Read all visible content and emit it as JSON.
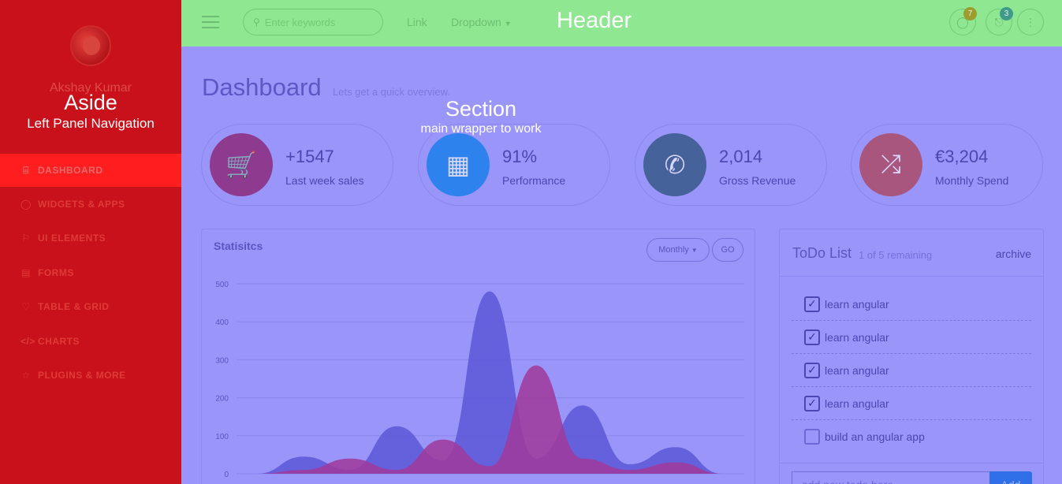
{
  "aside": {
    "user_name": "Akshay Kumar",
    "title": "Aside",
    "subtitle": "Left Panel Navigation",
    "nav": [
      {
        "label": "DASHBOARD",
        "icon": "bookmark-icon",
        "glyph": "⌸",
        "active": true
      },
      {
        "label": "WIDGETS & APPS",
        "icon": "comment-icon",
        "glyph": "◯",
        "active": false
      },
      {
        "label": "UI ELEMENTS",
        "icon": "flag-icon",
        "glyph": "⚐",
        "active": false
      },
      {
        "label": "FORMS",
        "icon": "file-icon",
        "glyph": "▤",
        "active": false
      },
      {
        "label": "TABLE & GRID",
        "icon": "heart-icon",
        "glyph": "♡",
        "active": false
      },
      {
        "label": "CHARTS",
        "icon": "code-icon",
        "glyph": "</>",
        "active": false
      },
      {
        "label": "PLUGINS & MORE",
        "icon": "star-icon",
        "glyph": "☆",
        "active": false
      }
    ]
  },
  "header": {
    "title": "Header",
    "search_placeholder": "Enter keywords",
    "link": "Link",
    "dropdown": "Dropdown",
    "messages_badge": "7",
    "notifications_badge": "3"
  },
  "main": {
    "title": "Dashboard",
    "subtitle": "Lets get a quick overview.",
    "section_title": "Section",
    "section_subtitle": "main wrapper to work",
    "stats": [
      {
        "value": "+1547",
        "label": "Last week sales",
        "icon": "cart-icon",
        "color": "#8e3a8e"
      },
      {
        "value": "91%",
        "label": "Performance",
        "icon": "qrcode-icon",
        "color": "#2d82ee"
      },
      {
        "value": "2,014",
        "label": "Gross Revenue",
        "icon": "phone-icon",
        "color": "#46629a"
      },
      {
        "value": "€3,204",
        "label": "Monthly Spend",
        "icon": "shuffle-icon",
        "color": "#a8567e"
      }
    ],
    "statistics": {
      "title": "Statisitcs",
      "period_select": "Monthly",
      "go_label": "GO"
    },
    "todo": {
      "title": "ToDo List",
      "count": "1 of 5 remaining",
      "archive": "archive",
      "items": [
        {
          "text": "learn angular",
          "done": true
        },
        {
          "text": "learn angular",
          "done": true
        },
        {
          "text": "learn angular",
          "done": true
        },
        {
          "text": "learn angular",
          "done": true
        },
        {
          "text": "build an angular app",
          "done": false
        }
      ],
      "input_placeholder": "add new todo here",
      "add_label": "Add"
    }
  },
  "chart_data": {
    "type": "area",
    "title": "Statisitcs",
    "xlabel": "",
    "ylabel": "",
    "ylim": [
      0,
      500
    ],
    "yticks": [
      "500",
      "400",
      "300",
      "200",
      "100",
      "0"
    ],
    "series": [
      {
        "color": "#5c58d8",
        "points": [
          [
            0,
            0
          ],
          [
            1,
            45
          ],
          [
            2,
            10
          ],
          [
            3,
            125
          ],
          [
            4,
            35
          ],
          [
            5,
            480
          ],
          [
            6,
            40
          ],
          [
            7,
            180
          ],
          [
            8,
            25
          ],
          [
            9,
            70
          ],
          [
            10,
            0
          ]
        ]
      },
      {
        "color": "#a03a9a",
        "points": [
          [
            0,
            0
          ],
          [
            1,
            10
          ],
          [
            2,
            40
          ],
          [
            3,
            10
          ],
          [
            4,
            90
          ],
          [
            5,
            20
          ],
          [
            6,
            285
          ],
          [
            7,
            40
          ],
          [
            8,
            10
          ],
          [
            9,
            30
          ],
          [
            10,
            0
          ]
        ]
      }
    ]
  }
}
